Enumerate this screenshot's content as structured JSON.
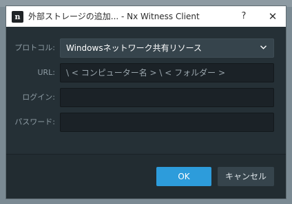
{
  "window": {
    "title": "外部ストレージの追加... - Nx Witness Client",
    "logo_text": "n",
    "help_glyph": "?",
    "close_glyph": "✕"
  },
  "form": {
    "protocol_label": "プロトコル:",
    "protocol_value": "Windowsネットワーク共有リソース",
    "url_label": "URL:",
    "url_placeholder": "\\ < コンピューター名 > \\ < フォルダー >",
    "login_label": "ログイン:",
    "login_value": "",
    "password_label": "パスワード:",
    "password_value": ""
  },
  "buttons": {
    "ok_label": "OK",
    "cancel_label": "キャンセル"
  },
  "colors": {
    "accent": "#2d9cdb",
    "dialog_bg": "#253036",
    "footer_bg": "#222c31"
  }
}
